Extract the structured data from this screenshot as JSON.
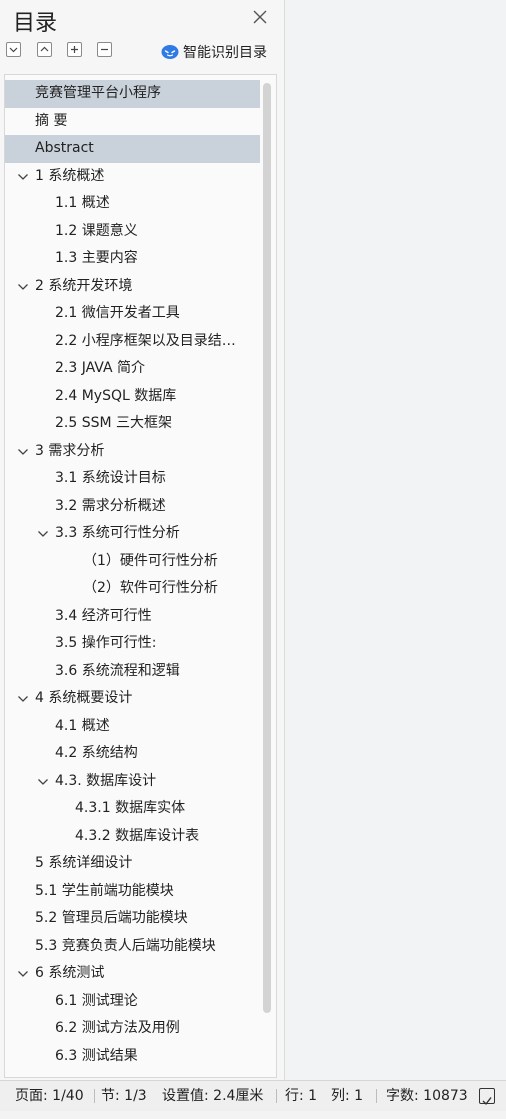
{
  "panel": {
    "title": "目录",
    "smart_label": "智能识别目录"
  },
  "toc": [
    {
      "label": "竞赛管理平台小程序",
      "level": 0,
      "selected": true,
      "expander": false
    },
    {
      "label": "摘  要",
      "level": 0,
      "selected": false,
      "expander": false
    },
    {
      "label": "Abstract",
      "level": 0,
      "selected": true,
      "expander": false
    },
    {
      "label": "1  系统概述",
      "level": 0,
      "selected": false,
      "expander": true
    },
    {
      "label": "1.1  概述",
      "level": 1,
      "selected": false,
      "expander": false
    },
    {
      "label": "1.2 课题意义",
      "level": 1,
      "selected": false,
      "expander": false
    },
    {
      "label": "1.3  主要内容",
      "level": 1,
      "selected": false,
      "expander": false
    },
    {
      "label": "2  系统开发环境",
      "level": 0,
      "selected": false,
      "expander": true
    },
    {
      "label": "2.1 微信开发者工具",
      "level": 1,
      "selected": false,
      "expander": false
    },
    {
      "label": "2.2 小程序框架以及目录结…",
      "level": 1,
      "selected": false,
      "expander": false
    },
    {
      "label": "2.3 JAVA 简介",
      "level": 1,
      "selected": false,
      "expander": false
    },
    {
      "label": "2.4 MySQL 数据库",
      "level": 1,
      "selected": false,
      "expander": false
    },
    {
      "label": "2.5 SSM 三大框架",
      "level": 1,
      "selected": false,
      "expander": false
    },
    {
      "label": "3  需求分析",
      "level": 0,
      "selected": false,
      "expander": true
    },
    {
      "label": "3.1  系统设计目标",
      "level": 1,
      "selected": false,
      "expander": false
    },
    {
      "label": "3.2 需求分析概述",
      "level": 1,
      "selected": false,
      "expander": false
    },
    {
      "label": "3.3  系统可行性分析",
      "level": 1,
      "selected": false,
      "expander": true
    },
    {
      "label": "（1）硬件可行性分析",
      "level": 2,
      "selected": false,
      "expander": false
    },
    {
      "label": "（2）软件可行性分析",
      "level": 2,
      "selected": false,
      "expander": false
    },
    {
      "label": "3.4 经济可行性",
      "level": 1,
      "selected": false,
      "expander": false
    },
    {
      "label": "3.5 操作可行性:",
      "level": 1,
      "selected": false,
      "expander": false
    },
    {
      "label": "3.6 系统流程和逻辑",
      "level": 1,
      "selected": false,
      "expander": false
    },
    {
      "label": "4 系统概要设计",
      "level": 0,
      "selected": false,
      "expander": true
    },
    {
      "label": "4.1  概述",
      "level": 1,
      "selected": false,
      "expander": false
    },
    {
      "label": "4.2  系统结构",
      "level": 1,
      "selected": false,
      "expander": false
    },
    {
      "label": "4.3.  数据库设计",
      "level": 1,
      "selected": false,
      "expander": true
    },
    {
      "label": "4.3.1  数据库实体",
      "level": 3,
      "selected": false,
      "expander": false
    },
    {
      "label": "4.3.2  数据库设计表",
      "level": 3,
      "selected": false,
      "expander": false
    },
    {
      "label": "5 系统详细设计",
      "level": 0,
      "selected": false,
      "expander": false
    },
    {
      "label": "5.1 学生前端功能模块",
      "level": 0,
      "selected": false,
      "expander": false
    },
    {
      "label": "5.2 管理员后端功能模块",
      "level": 0,
      "selected": false,
      "expander": false
    },
    {
      "label": "5.3 竞赛负责人后端功能模块",
      "level": 0,
      "selected": false,
      "expander": false
    },
    {
      "label": "6  系统测试",
      "level": 0,
      "selected": false,
      "expander": true
    },
    {
      "label": "6.1  测试理论",
      "level": 1,
      "selected": false,
      "expander": false
    },
    {
      "label": "6.2  测试方法及用例",
      "level": 1,
      "selected": false,
      "expander": false
    },
    {
      "label": "6.3 测试结果",
      "level": 1,
      "selected": false,
      "expander": false
    }
  ],
  "status": {
    "page": "页面: 1/40",
    "section": "节: 1/3",
    "setting": "设置值: 2.4厘米",
    "row": "行: 1",
    "col": "列: 1",
    "words": "字数: 10873"
  }
}
